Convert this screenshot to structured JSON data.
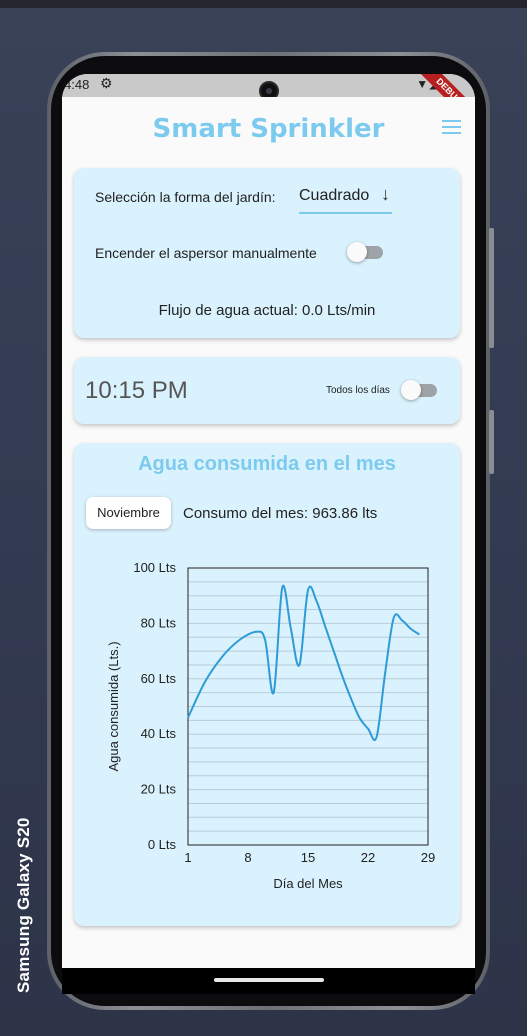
{
  "device": {
    "label": "Samsung Galaxy  S20"
  },
  "statusbar": {
    "time": "4:48",
    "gear_icon": "⚙",
    "icons": "▼◢▮"
  },
  "debug_banner": "DEBUG",
  "app": {
    "title": "Smart Sprinkler",
    "menu_icon": "hamburger-menu-icon"
  },
  "settings_card": {
    "shape_label": "Selección la forma del jardín:",
    "shape_value": "Cuadrado",
    "shape_arrow": "↓",
    "manual_label": "Encender el aspersor manualmente",
    "manual_on": false,
    "flow_text": "Flujo de agua actual: 0.0 Lts/min"
  },
  "schedule_card": {
    "time": "10:15 PM",
    "everyday_label": "Todos los días",
    "everyday_on": false
  },
  "consumption_card": {
    "title": "Agua consumida en el mes",
    "month_button": "Noviembre",
    "monthly_total": "Consumo del mes: 963.86 lts"
  },
  "colors": {
    "accent": "#7ccbef",
    "card": "#d9f2fd",
    "line": "#2e9bd6"
  },
  "chart_data": {
    "type": "line",
    "xlabel": "Día del Mes",
    "ylabel": "Agua consumida (Lts.)",
    "xlim": [
      1,
      29
    ],
    "ylim": [
      0,
      100
    ],
    "x_ticks": [
      "1",
      "8",
      "15",
      "22",
      "29"
    ],
    "y_ticks": [
      "0 Lts",
      "20 Lts",
      "40 Lts",
      "60 Lts",
      "80 Lts",
      "100 Lts"
    ],
    "grid": "horizontal",
    "x": [
      1,
      3,
      5,
      7,
      9,
      10,
      11,
      12,
      13,
      14,
      15,
      16,
      17,
      18,
      19,
      20,
      21,
      22,
      23,
      24,
      25,
      26,
      27,
      28
    ],
    "y": [
      46,
      59,
      68,
      74,
      77,
      74,
      55,
      93,
      78,
      65,
      92,
      88,
      79,
      70,
      61,
      53,
      46,
      42,
      39,
      62,
      82,
      81,
      78,
      76
    ]
  }
}
